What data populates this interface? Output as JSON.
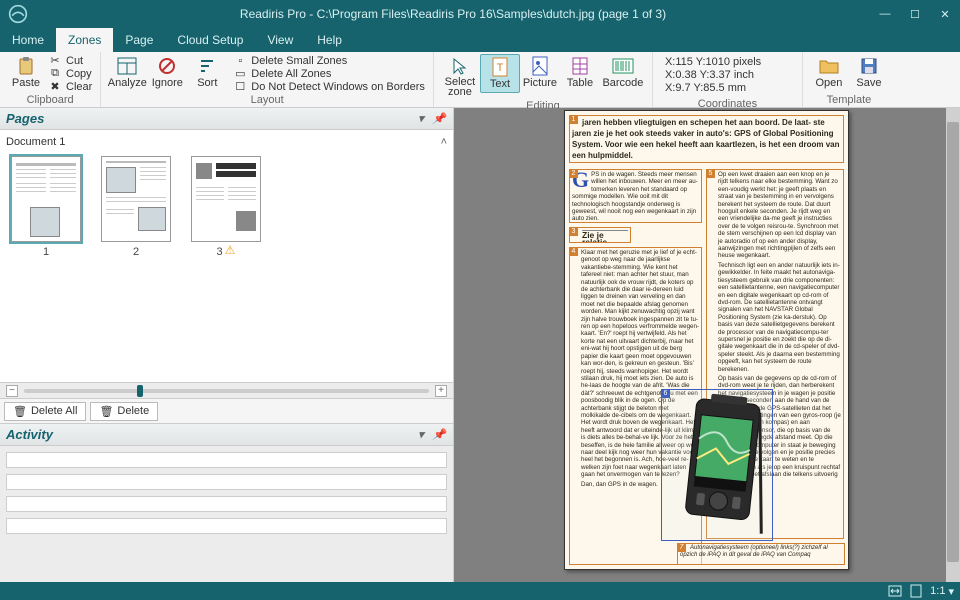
{
  "title": "Readiris Pro - C:\\Program Files\\Readiris Pro 16\\Samples\\dutch.jpg (page 1 of 3)",
  "menu": {
    "home": "Home",
    "zones": "Zones",
    "page": "Page",
    "cloud": "Cloud Setup",
    "view": "View",
    "help": "Help"
  },
  "ribbon": {
    "clipboard": {
      "label": "Clipboard",
      "paste": "Paste",
      "cut": "Cut",
      "copy": "Copy",
      "clear": "Clear"
    },
    "layout": {
      "label": "Layout",
      "analyze": "Analyze",
      "ignore": "Ignore",
      "sort": "Sort",
      "delsmall": "Delete Small Zones",
      "delall": "Delete All Zones",
      "nodetect": "Do Not Detect Windows on Borders"
    },
    "editing": {
      "label": "Editing",
      "select": "Select\nzone",
      "text": "Text",
      "picture": "Picture",
      "table": "Table",
      "barcode": "Barcode"
    },
    "coordinates": {
      "label": "Coordinates",
      "line1": "X:115  Y:1010 pixels",
      "line2": "X:0.38  Y:3.37 inch",
      "line3": "X:9.7  Y:85.5 mm"
    },
    "template": {
      "label": "Template",
      "open": "Open",
      "save": "Save"
    }
  },
  "pages": {
    "title": "Pages",
    "document": "Document 1",
    "thumbs": [
      {
        "n": "1"
      },
      {
        "n": "2"
      },
      {
        "n": "3"
      }
    ],
    "deleteAll": "Delete All",
    "delete": "Delete"
  },
  "activity": {
    "title": "Activity"
  },
  "doc": {
    "z1": "jaren hebben vliegtuigen en schepen het aan boord. De laat-\nste jaren zie je het ook steeds vaker in auto's: GPS of Global\nPositioning System. Voor wie een hekel heeft aan kaartlezen, is\nhet een droom van een hulpmiddel.",
    "z2_lead": "PS in de wagen. Steeds meer mensen willen het inbouwen. Meer en meer au-tomerken leveren het standaard op sommige modellen. Wie ooit mit dit technologisch hoogstandje onderweg is geweest, wil nooit nog een wegenkaart in zijn auto zien.",
    "z3": "Zie je relatie",
    "z4": "Klaar met het geruzie met je lief of je echt-genoot op weg naar de jaarlijkse vakantiebe-stemming. Wie kent het tafereel niet: man achter het stuur, man natuurlijk ook de vrouw",
    "z4b": "rijdt, de koters op de achterbank die daar ie-dereen luid liggen te dreinen van verveling en dan moet net die bepaalde afslag genomen worden. Man kijkt zenuwachtig opzij want zijn halve trouwboek ingespannen zit te tu-ren op een hopeloos verfrommelde wegen-kaart. 'En?' roept hij vertwijfeld. Als het korte nat een uitvaart dichterbij, maar het eni-wat hij hoort opstijgen uit de berg papier die kaart geen moet opgevouwen kan wor-den, is gekreun en gesteun. 'Bis' roept hij, steeds wanhopiger. Het wordt stilaan druk, hij moet iets zien. De auto is he-laas de hoogte van de afrit. 'Was die dàt?' schreeuwt de echtgenote nu met een poosboodig blik in de ogen. Op de achterbank stijgt de beleton met molkikalde de-cibels om de wegenkaart. Het wordt druk boven de wegenkaart. Het heeft antwoord dat er uiteinde-lijk uit klimt, is diets alles be-behal-ve lijk. Voor ze het beseffen, is de hele familie al weer op weg naar deel kijk nog weer hun vakantie voor-heel het begonnen is. Ach, hoe-veel re-welken zijn foet naar wegenkaart laten gaan het onvermogen van te lezen?",
    "z4c": "Dan, dan GPS in de wagen.",
    "z5a": "Op een kwet draaien aan een knop en je rijdt telkens naar elke bestemming. Want zo een-voudig werkt het: je geeft plaats en straat van je bestemming in en vervolgens berekent het systeem de route. Dat duurt hooguit enkele seconden. Je rijdt weg en een vriendelijke da-me geeft je instructies over de te volgen reisrou-te. Synchroon met de stem verschijnen op een lcd display van je autoradio of op een ander display, aanwijzingen met richtingpijlen of zelfs een heuse wegenkaart.",
    "z5b": "Technisch ligt een en ander natuurlijk iets in-gewikkelder. In feite maakt het autonaviga-tiesysteem gebruik van drie componenten: een satellietantenne, een navigatiecomputer en een digitale wegenkaart op cd-rom of dvd-rom. De satellietantenne ontvangt signalen van het NAVSTAR Global Positioning System (zie ka-derstuk). Op basis van deze satellietgegevens berekent de processor van de navigatiecompu-ter supersnel je positie en zoekt die op de di-gitale wegenkaart die in de cd-speler of dvd-speler steekt. Als je daarna een bestemming opgeeft, kan het systeem de route berekenen.",
    "z5c": "Op basis van de gegevens op de cd-rom of dvd-rom weet je te rijden, dan herberekent het navigatiesysteem in je wagen je positie en zoveel seconden aan de hand van de informatie van de GPS-satellieten dat het koppelt aan metingen van een gyros-roop (je maat waarin een kompas) en aan snelheidspulssensor, die op basis van de snelheid de gelegde afstand meet. Op die manier is de computer in staat je beweging nauw-keurig te volgen en je positie precies van de digitale kaart te weten en te waarschuwen als je op een kruispunt rechtaf of links af moet afslaan die telkens uitvoerig aan.",
    "z7": "Autonavigatiesysteem (optioneel) links(?) zichzelf al opzich de iPAQ in dit geval de iPAQ van Compaq"
  },
  "status": {
    "zoom": "1:1"
  }
}
